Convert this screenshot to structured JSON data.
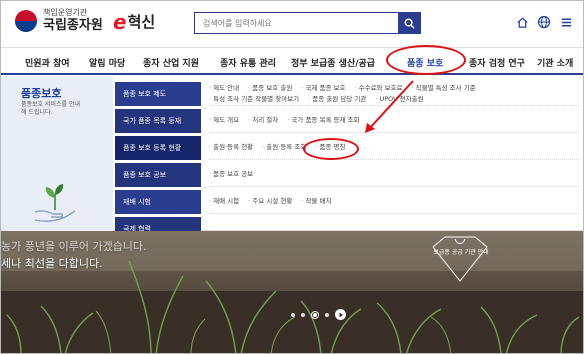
{
  "header": {
    "logo_sub": "책임운영기관",
    "logo_main": "국립종자원",
    "brand_e": "e",
    "brand_text": "혁신",
    "search_placeholder": "검색어를 입력하세요"
  },
  "gnb": {
    "items": [
      "민원과 참여",
      "알림 마당",
      "종자 산업 지원",
      "종자 유통 관리",
      "정부 보급종 생산/공급",
      "품종 보호",
      "종자 검정 연구",
      "기관 소개"
    ],
    "active_index": 5
  },
  "panel": {
    "title": "품종보호",
    "desc": "품종보호 서비스를 안내해 드립니다.",
    "sub_menu": [
      "품종 보호 제도",
      "국가 품종 목록 등재",
      "품종 보호 등록 현황",
      "품종 보호 공보",
      "재배 시험",
      "국제 협력"
    ],
    "links": [
      [
        "제도 안내",
        "품종 보호 출원",
        "국제 품종 보호",
        "수수료와 보호료",
        "작물별 특성 조사 기준",
        "특성 조사 기준 작물별 찾아보기",
        "품종 출원 담당 기관",
        "UPOV 전자출원"
      ],
      [
        "제도 개요",
        "처리 절차",
        "국가 품종 목록 등재 조회"
      ],
      [
        "출원·등록 현황",
        "출원·등록 조회",
        "품종 명칭"
      ],
      [
        "품종 보호 공보"
      ],
      [
        "재배 시험",
        "주요 시설 현황",
        "작물 배치"
      ],
      []
    ]
  },
  "hero": {
    "line1": "농가 풍년을 이루어 가겠습니다.",
    "line2": "세나 최선을 다합니다.",
    "badge": "보급종 공급 기관 안내"
  },
  "colors": {
    "primary": "#2a3d8f",
    "annotation": "#dd1111",
    "brand_red": "#e11d2b"
  }
}
